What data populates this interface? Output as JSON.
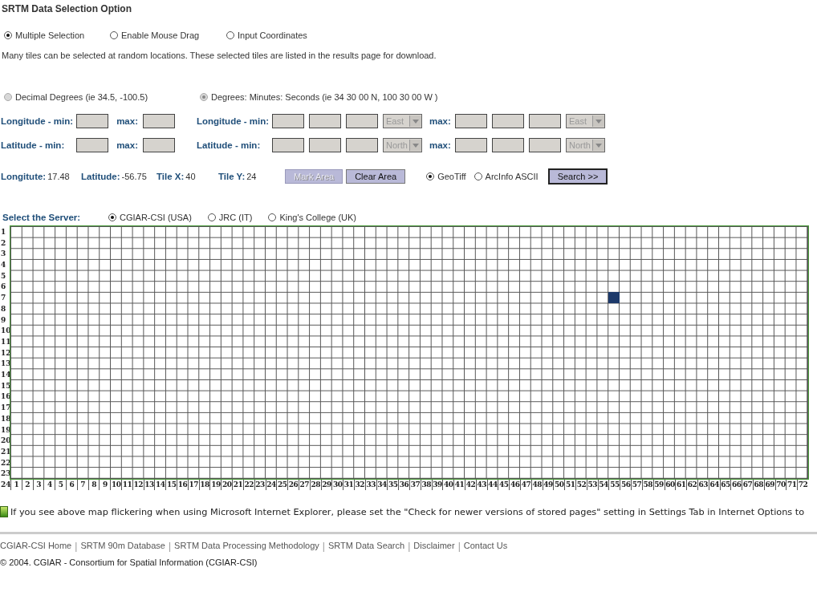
{
  "title": "SRTM Data Selection Option",
  "selection_modes": [
    {
      "label": "Multiple Selection",
      "selected": true
    },
    {
      "label": "Enable Mouse Drag",
      "selected": false
    },
    {
      "label": "Input Coordinates",
      "selected": false
    }
  ],
  "description": "Many tiles can be selected at random locations. These selected tiles are listed in the results page for download.",
  "coordinate_formats": [
    {
      "label": "Decimal Degrees (ie 34.5, -100.5)",
      "selected": false,
      "disabled": true
    },
    {
      "label": "Degrees: Minutes: Seconds (ie 34 30 00 N, 100 30 00 W )",
      "selected": true,
      "disabled": true
    }
  ],
  "decimal_rows": [
    {
      "min_label": "Longitude - min:",
      "max_label": "max:"
    },
    {
      "min_label": "Latitude - min:",
      "max_label": "max:"
    }
  ],
  "dms_rows": [
    {
      "min_label": "Longitude - min:",
      "min_direction": "East",
      "max_label": "max:",
      "max_direction": "East"
    },
    {
      "min_label": "Latitude - min:",
      "min_direction": "North",
      "max_label": "max:",
      "max_direction": "North"
    }
  ],
  "readouts": [
    {
      "label": "Longitute:",
      "value": "17.48"
    },
    {
      "label": "Latitude:",
      "value": "-56.75"
    },
    {
      "label": "Tile X:",
      "value": "40"
    },
    {
      "label": "Tile Y:",
      "value": "24"
    }
  ],
  "area_buttons": [
    {
      "label": "Mark Area",
      "disabled": true
    },
    {
      "label": "Clear Area",
      "disabled": false
    }
  ],
  "formats": [
    {
      "label": "GeoTiff",
      "selected": true
    },
    {
      "label": "ArcInfo ASCII",
      "selected": false
    }
  ],
  "search_button": "Search >>",
  "server": {
    "label": "Select the Server:",
    "options": [
      {
        "label": "CGIAR-CSI (USA)",
        "selected": true
      },
      {
        "label": "JRC (IT)",
        "selected": false
      },
      {
        "label": "King's College (UK)",
        "selected": false
      }
    ]
  },
  "map": {
    "row_labels": [
      {
        "label": "1",
        "selected": false
      },
      {
        "label": "2",
        "selected": false
      },
      {
        "label": "3",
        "selected": false
      },
      {
        "label": "4",
        "selected": false
      },
      {
        "label": "5",
        "selected": false
      },
      {
        "label": "6",
        "selected": false
      },
      {
        "label": "7",
        "selected": true
      },
      {
        "label": "8",
        "selected": false
      },
      {
        "label": "9",
        "selected": false
      },
      {
        "label": "10",
        "selected": false
      },
      {
        "label": "11",
        "selected": false
      },
      {
        "label": "12",
        "selected": false
      },
      {
        "label": "13",
        "selected": false
      },
      {
        "label": "14",
        "selected": false
      },
      {
        "label": "15",
        "selected": false
      },
      {
        "label": "16",
        "selected": false
      },
      {
        "label": "17",
        "selected": false
      },
      {
        "label": "18",
        "selected": false
      },
      {
        "label": "19",
        "selected": false
      },
      {
        "label": "20",
        "selected": false
      },
      {
        "label": "21",
        "selected": false
      },
      {
        "label": "22",
        "selected": false
      },
      {
        "label": "23",
        "selected": false
      }
    ],
    "corner_label": "24",
    "column_labels": [
      {
        "label": "1",
        "selected": false
      },
      {
        "label": "2",
        "selected": false
      },
      {
        "label": "3",
        "selected": false
      },
      {
        "label": "4",
        "selected": false
      },
      {
        "label": "5",
        "selected": false
      },
      {
        "label": "6",
        "selected": false
      },
      {
        "label": "7",
        "selected": false
      },
      {
        "label": "8",
        "selected": false
      },
      {
        "label": "9",
        "selected": false
      },
      {
        "label": "10",
        "selected": false
      },
      {
        "label": "11",
        "selected": false
      },
      {
        "label": "12",
        "selected": false
      },
      {
        "label": "13",
        "selected": false
      },
      {
        "label": "14",
        "selected": false
      },
      {
        "label": "15",
        "selected": false
      },
      {
        "label": "16",
        "selected": false
      },
      {
        "label": "17",
        "selected": false
      },
      {
        "label": "18",
        "selected": false
      },
      {
        "label": "19",
        "selected": false
      },
      {
        "label": "20",
        "selected": false
      },
      {
        "label": "21",
        "selected": false
      },
      {
        "label": "22",
        "selected": false
      },
      {
        "label": "23",
        "selected": false
      },
      {
        "label": "24",
        "selected": false
      },
      {
        "label": "25",
        "selected": false
      },
      {
        "label": "26",
        "selected": false
      },
      {
        "label": "27",
        "selected": false
      },
      {
        "label": "28",
        "selected": false
      },
      {
        "label": "29",
        "selected": false
      },
      {
        "label": "30",
        "selected": false
      },
      {
        "label": "31",
        "selected": false
      },
      {
        "label": "32",
        "selected": false
      },
      {
        "label": "33",
        "selected": false
      },
      {
        "label": "34",
        "selected": false
      },
      {
        "label": "35",
        "selected": false
      },
      {
        "label": "36",
        "selected": false
      },
      {
        "label": "37",
        "selected": false
      },
      {
        "label": "38",
        "selected": false
      },
      {
        "label": "39",
        "selected": false
      },
      {
        "label": "40",
        "selected": false
      },
      {
        "label": "41",
        "selected": false
      },
      {
        "label": "42",
        "selected": false
      },
      {
        "label": "43",
        "selected": false
      },
      {
        "label": "44",
        "selected": false
      },
      {
        "label": "45",
        "selected": false
      },
      {
        "label": "46",
        "selected": false
      },
      {
        "label": "47",
        "selected": false
      },
      {
        "label": "48",
        "selected": false
      },
      {
        "label": "49",
        "selected": false
      },
      {
        "label": "50",
        "selected": false
      },
      {
        "label": "51",
        "selected": false
      },
      {
        "label": "52",
        "selected": false
      },
      {
        "label": "53",
        "selected": false
      },
      {
        "label": "54",
        "selected": false
      },
      {
        "label": "55",
        "selected": true
      },
      {
        "label": "56",
        "selected": false
      },
      {
        "label": "57",
        "selected": false
      },
      {
        "label": "58",
        "selected": false
      },
      {
        "label": "59",
        "selected": false
      },
      {
        "label": "60",
        "selected": false
      },
      {
        "label": "61",
        "selected": false
      },
      {
        "label": "62",
        "selected": false
      },
      {
        "label": "63",
        "selected": false
      },
      {
        "label": "64",
        "selected": false
      },
      {
        "label": "65",
        "selected": false
      },
      {
        "label": "66",
        "selected": false
      },
      {
        "label": "67",
        "selected": false
      },
      {
        "label": "68",
        "selected": false
      },
      {
        "label": "69",
        "selected": false
      },
      {
        "label": "70",
        "selected": false
      },
      {
        "label": "71",
        "selected": false
      },
      {
        "label": "72",
        "selected": false
      }
    ]
  },
  "note": "If you see above map flickering when using Microsoft Internet Explorer, please set the \"Check for newer versions of stored pages\" setting in Settings Tab in Internet Options to",
  "footer": [
    {
      "kind": "link",
      "text": "CGIAR-CSI Home"
    },
    {
      "kind": "separator",
      "text": "|"
    },
    {
      "kind": "link",
      "text": "SRTM 90m Database"
    },
    {
      "kind": "separator",
      "text": "|"
    },
    {
      "kind": "link",
      "text": "SRTM Data Processing Methodology"
    },
    {
      "kind": "separator",
      "text": "|"
    },
    {
      "kind": "link",
      "text": "SRTM Data Search"
    },
    {
      "kind": "separator",
      "text": "|"
    },
    {
      "kind": "link",
      "text": "Disclaimer"
    },
    {
      "kind": "separator",
      "text": "|"
    },
    {
      "kind": "link",
      "text": "Contact Us"
    }
  ],
  "copyright": "© 2004. CGIAR - Consortium for Spatial Information (CGIAR-CSI)"
}
